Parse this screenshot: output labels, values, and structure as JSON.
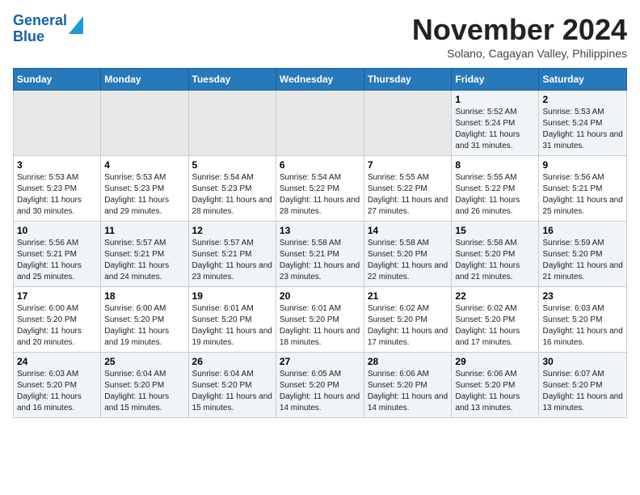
{
  "logo": {
    "line1": "General",
    "line2": "Blue"
  },
  "title": "November 2024",
  "subtitle": "Solano, Cagayan Valley, Philippines",
  "headers": [
    "Sunday",
    "Monday",
    "Tuesday",
    "Wednesday",
    "Thursday",
    "Friday",
    "Saturday"
  ],
  "weeks": [
    [
      {
        "day": "",
        "info": ""
      },
      {
        "day": "",
        "info": ""
      },
      {
        "day": "",
        "info": ""
      },
      {
        "day": "",
        "info": ""
      },
      {
        "day": "",
        "info": ""
      },
      {
        "day": "1",
        "info": "Sunrise: 5:52 AM\nSunset: 5:24 PM\nDaylight: 11 hours and 31 minutes."
      },
      {
        "day": "2",
        "info": "Sunrise: 5:53 AM\nSunset: 5:24 PM\nDaylight: 11 hours and 31 minutes."
      }
    ],
    [
      {
        "day": "3",
        "info": "Sunrise: 5:53 AM\nSunset: 5:23 PM\nDaylight: 11 hours and 30 minutes."
      },
      {
        "day": "4",
        "info": "Sunrise: 5:53 AM\nSunset: 5:23 PM\nDaylight: 11 hours and 29 minutes."
      },
      {
        "day": "5",
        "info": "Sunrise: 5:54 AM\nSunset: 5:23 PM\nDaylight: 11 hours and 28 minutes."
      },
      {
        "day": "6",
        "info": "Sunrise: 5:54 AM\nSunset: 5:22 PM\nDaylight: 11 hours and 28 minutes."
      },
      {
        "day": "7",
        "info": "Sunrise: 5:55 AM\nSunset: 5:22 PM\nDaylight: 11 hours and 27 minutes."
      },
      {
        "day": "8",
        "info": "Sunrise: 5:55 AM\nSunset: 5:22 PM\nDaylight: 11 hours and 26 minutes."
      },
      {
        "day": "9",
        "info": "Sunrise: 5:56 AM\nSunset: 5:21 PM\nDaylight: 11 hours and 25 minutes."
      }
    ],
    [
      {
        "day": "10",
        "info": "Sunrise: 5:56 AM\nSunset: 5:21 PM\nDaylight: 11 hours and 25 minutes."
      },
      {
        "day": "11",
        "info": "Sunrise: 5:57 AM\nSunset: 5:21 PM\nDaylight: 11 hours and 24 minutes."
      },
      {
        "day": "12",
        "info": "Sunrise: 5:57 AM\nSunset: 5:21 PM\nDaylight: 11 hours and 23 minutes."
      },
      {
        "day": "13",
        "info": "Sunrise: 5:58 AM\nSunset: 5:21 PM\nDaylight: 11 hours and 23 minutes."
      },
      {
        "day": "14",
        "info": "Sunrise: 5:58 AM\nSunset: 5:20 PM\nDaylight: 11 hours and 22 minutes."
      },
      {
        "day": "15",
        "info": "Sunrise: 5:58 AM\nSunset: 5:20 PM\nDaylight: 11 hours and 21 minutes."
      },
      {
        "day": "16",
        "info": "Sunrise: 5:59 AM\nSunset: 5:20 PM\nDaylight: 11 hours and 21 minutes."
      }
    ],
    [
      {
        "day": "17",
        "info": "Sunrise: 6:00 AM\nSunset: 5:20 PM\nDaylight: 11 hours and 20 minutes."
      },
      {
        "day": "18",
        "info": "Sunrise: 6:00 AM\nSunset: 5:20 PM\nDaylight: 11 hours and 19 minutes."
      },
      {
        "day": "19",
        "info": "Sunrise: 6:01 AM\nSunset: 5:20 PM\nDaylight: 11 hours and 19 minutes."
      },
      {
        "day": "20",
        "info": "Sunrise: 6:01 AM\nSunset: 5:20 PM\nDaylight: 11 hours and 18 minutes."
      },
      {
        "day": "21",
        "info": "Sunrise: 6:02 AM\nSunset: 5:20 PM\nDaylight: 11 hours and 17 minutes."
      },
      {
        "day": "22",
        "info": "Sunrise: 6:02 AM\nSunset: 5:20 PM\nDaylight: 11 hours and 17 minutes."
      },
      {
        "day": "23",
        "info": "Sunrise: 6:03 AM\nSunset: 5:20 PM\nDaylight: 11 hours and 16 minutes."
      }
    ],
    [
      {
        "day": "24",
        "info": "Sunrise: 6:03 AM\nSunset: 5:20 PM\nDaylight: 11 hours and 16 minutes."
      },
      {
        "day": "25",
        "info": "Sunrise: 6:04 AM\nSunset: 5:20 PM\nDaylight: 11 hours and 15 minutes."
      },
      {
        "day": "26",
        "info": "Sunrise: 6:04 AM\nSunset: 5:20 PM\nDaylight: 11 hours and 15 minutes."
      },
      {
        "day": "27",
        "info": "Sunrise: 6:05 AM\nSunset: 5:20 PM\nDaylight: 11 hours and 14 minutes."
      },
      {
        "day": "28",
        "info": "Sunrise: 6:06 AM\nSunset: 5:20 PM\nDaylight: 11 hours and 14 minutes."
      },
      {
        "day": "29",
        "info": "Sunrise: 6:06 AM\nSunset: 5:20 PM\nDaylight: 11 hours and 13 minutes."
      },
      {
        "day": "30",
        "info": "Sunrise: 6:07 AM\nSunset: 5:20 PM\nDaylight: 11 hours and 13 minutes."
      }
    ]
  ]
}
